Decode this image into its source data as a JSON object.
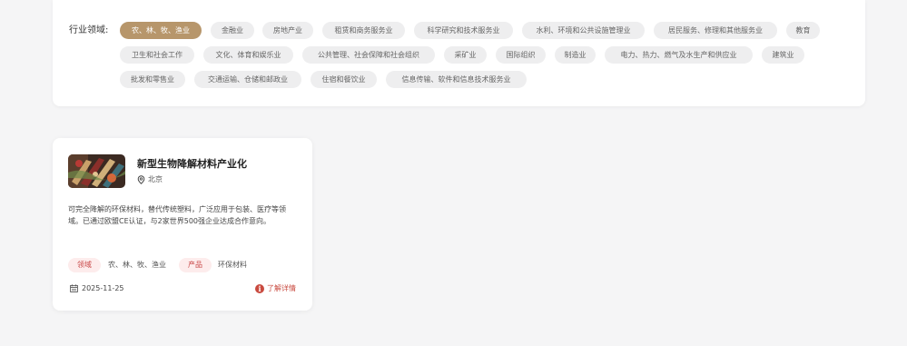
{
  "filter": {
    "label": "行业领域:",
    "tags": [
      "农、林、牧、渔业",
      "金融业",
      "房地产业",
      "租赁和商务服务业",
      "科学研究和技术服务业",
      "水利、环境和公共设施管理业",
      "居民服务、修理和其他服务业",
      "教育",
      "卫生和社会工作",
      "文化、体育和娱乐业",
      "公共管理、社会保障和社会组织",
      "采矿业",
      "国际组织",
      "制造业",
      "电力、热力、燃气及水生产和供应业",
      "建筑业",
      "批发和零售业",
      "交通运输、仓储和邮政业",
      "住宿和餐饮业",
      "信息传输、软件和信息技术服务业"
    ]
  },
  "project": {
    "title": "新型生物降解材料产业化",
    "location": "北京",
    "description": "可完全降解的环保材料，替代传统塑料，广泛应用于包装、医疗等领域。已通过欧盟CE认证，与2家世界500强企业达成合作意向。",
    "field_label": "领域",
    "field_value": "农、林、牧、渔业",
    "product_label": "产品",
    "product_value": "环保材料",
    "date": "2025-11-25",
    "detail_label": "了解详情"
  },
  "colors": {
    "active_tag": "#b7966b",
    "accent_red": "#c94a3f",
    "pill_bg": "#fdecec"
  },
  "icons": [
    "location-pin-icon",
    "calendar-icon",
    "info-icon"
  ]
}
